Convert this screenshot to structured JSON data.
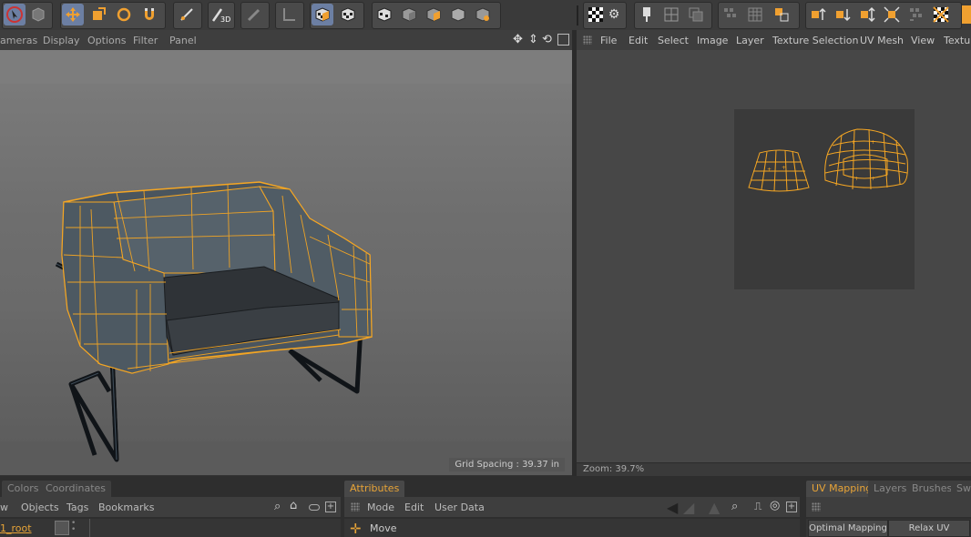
{
  "toolbar": {
    "groups": [
      "selection",
      "transform",
      "modeling",
      "paint",
      "render",
      "uv-tools"
    ]
  },
  "viewport": {
    "menu": [
      "ameras",
      "Display",
      "Options",
      "Filter",
      "Panel"
    ],
    "grid_spacing": "Grid Spacing : 39.37 in"
  },
  "uv_editor": {
    "menu": [
      "File",
      "Edit",
      "Select",
      "Image",
      "Layer",
      "Texture Selection",
      "UV Mesh",
      "View",
      "Textur"
    ],
    "zoom": "Zoom: 39.7%"
  },
  "object_manager": {
    "tabs": [
      "Colors",
      "Coordinates"
    ],
    "menu": [
      "w",
      "Objects",
      "Tags",
      "Bookmarks"
    ],
    "row_label": "1_root"
  },
  "attributes": {
    "tab": "Attributes",
    "menu": [
      "Mode",
      "Edit",
      "User Data"
    ],
    "row_label": "Move"
  },
  "uv_panel": {
    "tabs": [
      "UV Mapping",
      "Layers",
      "Brushes",
      "Swa"
    ],
    "buttons": [
      "Optimal Mapping",
      "Relax UV"
    ]
  },
  "colors": {
    "accent": "#e8a437",
    "wire": "#f5a623",
    "selected_tool": "#6c7fa3"
  }
}
